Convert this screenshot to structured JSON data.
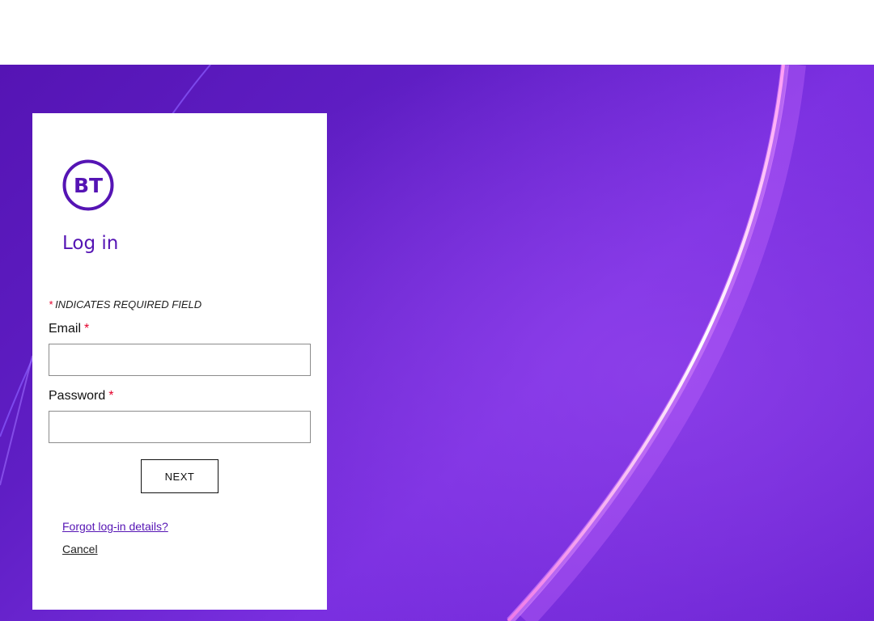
{
  "brand": {
    "logo_text": "BT",
    "color": "#5514b4",
    "required_color": "#e4002b"
  },
  "login": {
    "title": "Log in",
    "required_star": "*",
    "required_note": "INDICATES REQUIRED FIELD",
    "email_label": "Email",
    "email_value": "",
    "password_label": "Password",
    "password_value": "",
    "next_label": "NEXT",
    "forgot_label": "Forgot log-in details?",
    "cancel_label": "Cancel"
  }
}
